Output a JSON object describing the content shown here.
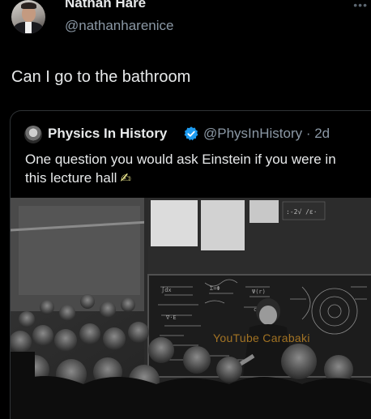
{
  "tweet": {
    "author_name": "Nathan Hare",
    "author_handle": "@nathanharenice",
    "text": "Can I go to the bathroom",
    "more_icon": "ellipsis-icon"
  },
  "quoted_tweet": {
    "author_name": "Physics In History",
    "verified": true,
    "handle_and_time": "@PhysInHistory · 2d",
    "text": "One question you would ask Einstein if you were in this lecture hall",
    "emoji_icon": "writing-hand-icon",
    "image": {
      "subject": "black-and-white photo of Einstein lecturing at a chalkboard",
      "watermark": "YouTube Carabaki"
    }
  },
  "colors": {
    "background": "#000000",
    "primary_text": "#e7e9ea",
    "secondary_text": "#8b98a5",
    "verified_blue": "#1d9bf0",
    "card_border": "#2f3336"
  }
}
